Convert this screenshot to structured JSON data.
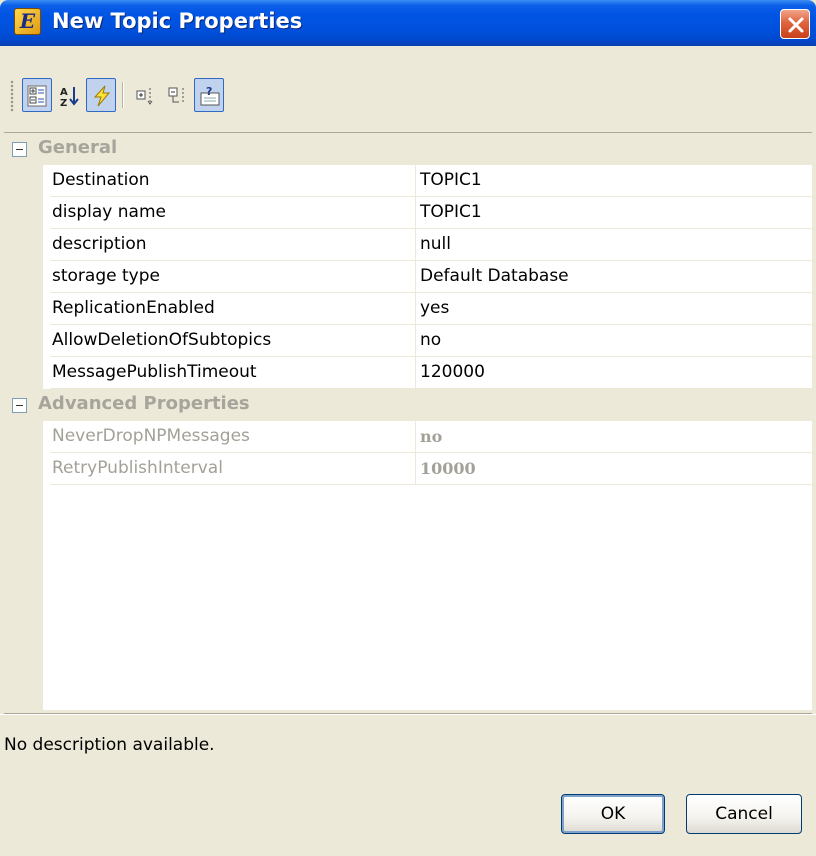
{
  "window": {
    "title": "New Topic Properties",
    "app_icon_glyph": "E"
  },
  "toolbar": {
    "icons": [
      "categorized-view-icon",
      "alphabetical-sort-icon",
      "lightning-events-icon",
      "expand-all-icon",
      "collapse-all-icon",
      "help-icon"
    ]
  },
  "grid": {
    "categories": [
      {
        "label": "General",
        "properties": [
          {
            "name": "Destination",
            "value": "TOPIC1"
          },
          {
            "name": "display name",
            "value": "TOPIC1"
          },
          {
            "name": "description",
            "value": "null"
          },
          {
            "name": "storage type",
            "value": "Default Database"
          },
          {
            "name": "ReplicationEnabled",
            "value": "yes"
          },
          {
            "name": "AllowDeletionOfSubtopics",
            "value": "no"
          },
          {
            "name": "MessagePublishTimeout",
            "value": "120000"
          }
        ]
      },
      {
        "label": "Advanced Properties",
        "properties": [
          {
            "name": "NeverDropNPMessages",
            "value": "no"
          },
          {
            "name": "RetryPublishInterval",
            "value": "10000"
          }
        ]
      }
    ]
  },
  "description_panel": {
    "text": "No description available."
  },
  "buttons": {
    "ok_label": "OK",
    "cancel_label": "Cancel"
  },
  "colors": {
    "titlebar": "#0054e3",
    "close_button": "#e0643e",
    "toolbar_active": "#c1d2ee",
    "disabled_text": "#a3a197"
  }
}
